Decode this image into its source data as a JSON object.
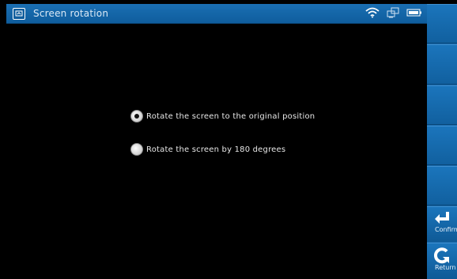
{
  "window": {
    "title": "Screen rotation"
  },
  "status": {
    "icons": [
      "wifi-icon",
      "network-icon",
      "battery-icon"
    ]
  },
  "options": [
    {
      "label": "Rotate the screen to the original position",
      "selected": true
    },
    {
      "label": "Rotate the screen by 180 degrees",
      "selected": false
    }
  ],
  "sidebar": {
    "confirm_label": "Confirm",
    "return_label": "Return"
  },
  "colors": {
    "accent": "#1566a8",
    "background": "#000000"
  }
}
